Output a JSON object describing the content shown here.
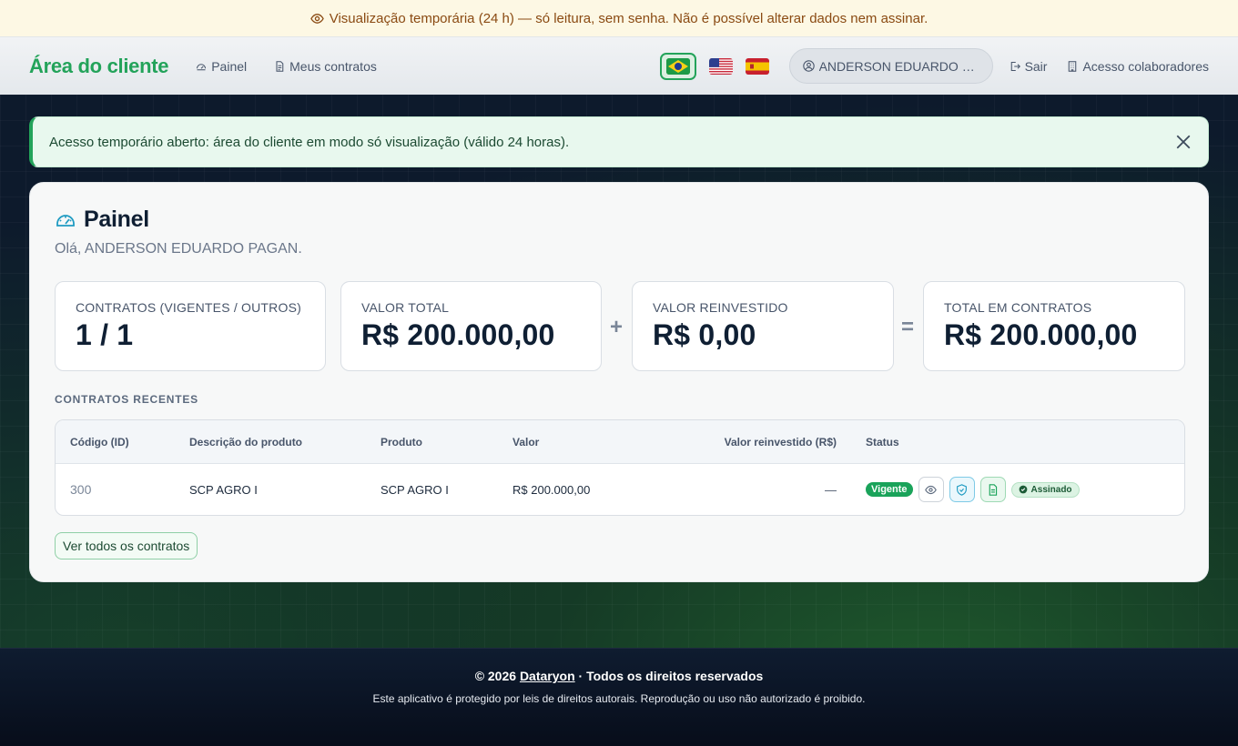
{
  "banner": {
    "text": "Visualização temporária (24 h) — só leitura, sem senha. Não é possível alterar dados nem assinar.",
    "icon": "eye-icon"
  },
  "nav": {
    "brand": "Área do cliente",
    "links": [
      {
        "label": "Painel",
        "icon": "dashboard-icon"
      },
      {
        "label": "Meus contratos",
        "icon": "document-icon"
      }
    ],
    "languages": [
      {
        "name": "Português (Brasil)",
        "active": true,
        "icon": "flag-br-icon"
      },
      {
        "name": "English (US)",
        "active": false,
        "icon": "flag-us-icon"
      },
      {
        "name": "Español",
        "active": false,
        "icon": "flag-es-icon"
      }
    ],
    "user": "ANDERSON EDUARDO PA...",
    "logout": "Sair",
    "staff_access": "Acesso colaboradores"
  },
  "alert": {
    "text": "Acesso temporário aberto: área do cliente em modo só visualização (válido 24 horas)."
  },
  "dashboard": {
    "title": "Painel",
    "greeting": "Olá, ANDERSON EDUARDO PAGAN.",
    "stats": [
      {
        "label": "CONTRATOS (VIGENTES / OUTROS)",
        "value": "1 / 1"
      },
      {
        "label": "VALOR TOTAL",
        "value": "R$ 200.000,00"
      },
      {
        "label": "VALOR REINVESTIDO",
        "value": "R$ 0,00"
      },
      {
        "label": "TOTAL EM CONTRATOS",
        "value": "R$ 200.000,00"
      }
    ],
    "operators": {
      "plus": "+",
      "equals": "="
    },
    "recent_label": "CONTRATOS RECENTES",
    "table": {
      "headers": [
        "Código (ID)",
        "Descrição do produto",
        "Produto",
        "Valor",
        "Valor reinvestido (R$)",
        "Status"
      ],
      "rows": [
        {
          "id": "300",
          "description": "SCP AGRO I",
          "product": "SCP AGRO I",
          "value": "R$ 200.000,00",
          "reinvested": "—",
          "status": "Vigente",
          "signed": "Assinado"
        }
      ]
    },
    "view_all": "Ver todos os contratos"
  },
  "footer": {
    "copyright_prefix": "© 2026",
    "company": "Dataryon",
    "copyright_suffix": "· Todos os direitos reservados",
    "notice": "Este aplicativo é protegido por leis de direitos autorais. Reprodução ou uso não autorizado é proibido."
  },
  "colors": {
    "brand_green": "#23a35a",
    "banner_bg": "#fdf8e4",
    "banner_text": "#8a4a12",
    "alert_bg": "#e8f8ee",
    "dark_bg": "#0b1628"
  }
}
